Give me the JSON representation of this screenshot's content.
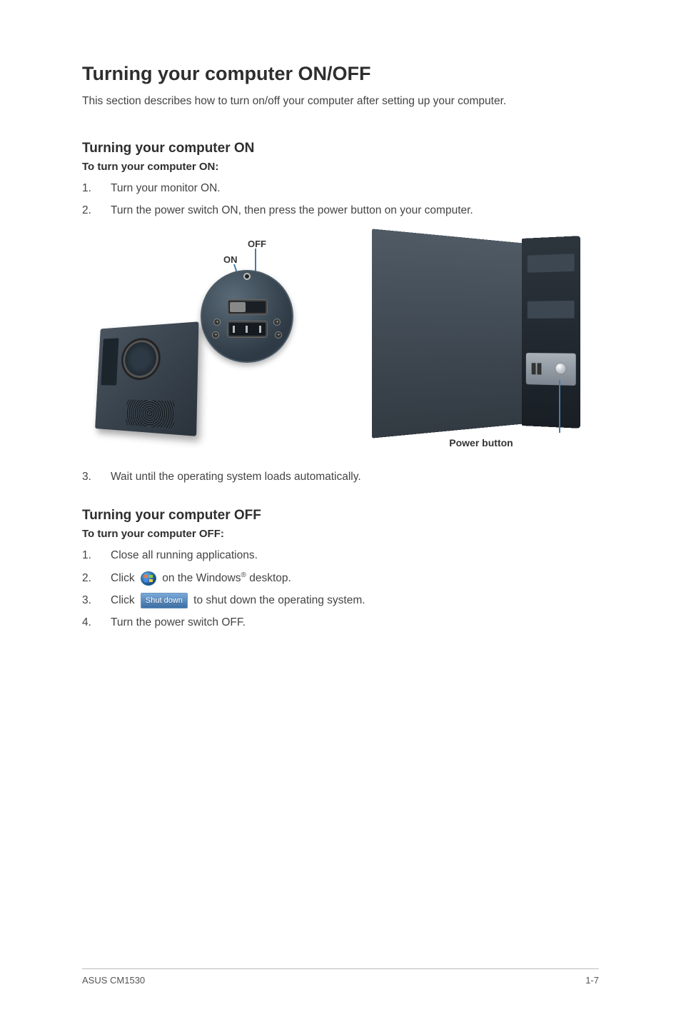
{
  "title": "Turning your computer ON/OFF",
  "intro": "This section describes how to turn on/off your computer after setting up your computer.",
  "on": {
    "heading": "Turning your computer ON",
    "subhead": "To turn your computer ON:",
    "steps": [
      "Turn your monitor ON.",
      "Turn the power switch ON, then press the power button on your computer."
    ],
    "step3_num": "3.",
    "step3": "Wait until the operating system loads automatically."
  },
  "labels": {
    "off": "OFF",
    "on": "ON",
    "power_button": "Power button"
  },
  "off": {
    "heading": "Turning your computer OFF",
    "subhead": "To turn your computer OFF:",
    "steps": {
      "s1": "Close all running applications.",
      "s2_pre": "Click ",
      "s2_post_pre": " on the Windows",
      "s2_post_suf": " desktop.",
      "s3_pre": "Click ",
      "s3_btn": "Shut down",
      "s3_post": " to shut down the operating system.",
      "s4": "Turn the power switch OFF."
    }
  },
  "nums": {
    "n1": "1.",
    "n2": "2.",
    "n3": "3.",
    "n4": "4."
  },
  "reg": "®",
  "footer": {
    "left": "ASUS CM1530",
    "right": "1-7"
  }
}
